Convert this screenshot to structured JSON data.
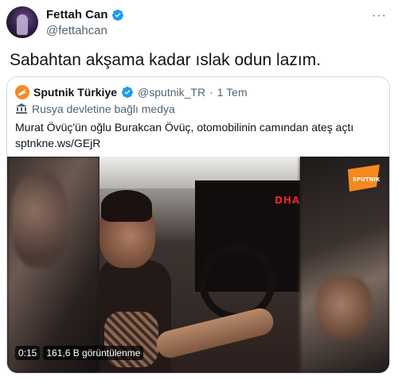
{
  "author": {
    "name": "Fettah Can",
    "handle": "@fettahcan"
  },
  "tweet": {
    "text": "Sabahtan akşama kadar ıslak odun lazım."
  },
  "quoted": {
    "name": "Sputnik Türkiye",
    "handle": "@sputnik_TR",
    "separator": "·",
    "time": "1 Tem",
    "label": "Rusya devletine bağlı medya",
    "text_line1": "Murat Övüç'ün oğlu Burakcan Övüç, otomobilinin camından ateş açtı",
    "text_line2": "sptnkne.ws/GEjR",
    "video": {
      "duration": "0:15",
      "views": "161,6 B görüntülenme",
      "watermark": "DHA",
      "badge_text": "SPUTNIK"
    }
  },
  "colors": {
    "verified": "#1d9bf0",
    "muted": "#536471",
    "border": "#cfd9de",
    "sputnik": "#f58a1f"
  },
  "icons": [
    "verified-badge-icon",
    "more-options-icon",
    "state-media-icon",
    "sputnik-logo-icon"
  ]
}
